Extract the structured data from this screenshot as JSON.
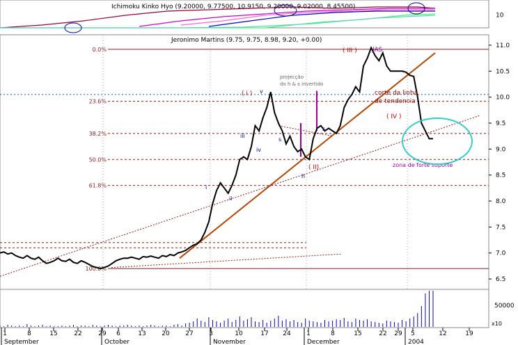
{
  "chart_data": {
    "type": "line",
    "top_panel": {
      "title": "Ichimoku Kinko Hyo (9.20000, 9.77500, 10.9150, 9.20000, 9.02000, 8.45500)",
      "y_ticks": [
        {
          "v": 10,
          "label": "10"
        }
      ],
      "ylim": [
        9.0,
        10.6
      ]
    },
    "main_panel": {
      "title": "Jeronimo Martins (9.75, 9.75, 8.98, 9.20, +0.00)",
      "ylim": [
        6.3,
        11.2
      ],
      "y_ticks": [
        {
          "v": 11.0,
          "label": "11.0"
        },
        {
          "v": 10.5,
          "label": "10.5"
        },
        {
          "v": 10.0,
          "label": "10.0"
        },
        {
          "v": 9.5,
          "label": "9.5"
        },
        {
          "v": 9.0,
          "label": "9.0"
        },
        {
          "v": 8.5,
          "label": "8.5"
        },
        {
          "v": 8.0,
          "label": "8.0"
        },
        {
          "v": 7.5,
          "label": "7.5"
        },
        {
          "v": 7.0,
          "label": "7.0"
        },
        {
          "v": 6.5,
          "label": "6.5"
        }
      ],
      "price_series": {
        "name": "Jeronimo Martins",
        "color": "#000000",
        "values": [
          7.0,
          7.02,
          6.98,
          7.0,
          6.95,
          6.92,
          6.9,
          6.95,
          6.9,
          6.88,
          6.92,
          6.85,
          6.8,
          6.82,
          6.85,
          6.9,
          6.85,
          6.84,
          6.88,
          6.82,
          6.8,
          6.85,
          6.82,
          6.78,
          6.74,
          6.72,
          6.7,
          6.72,
          6.75,
          6.8,
          6.85,
          6.88,
          6.9,
          6.9,
          6.92,
          6.9,
          6.88,
          6.93,
          6.92,
          6.94,
          6.92,
          6.9,
          6.95,
          6.93,
          6.97,
          6.95,
          7.0,
          7.02,
          7.05,
          7.1,
          7.15,
          7.18,
          7.25,
          7.4,
          7.6,
          7.95,
          8.2,
          8.35,
          8.25,
          8.15,
          8.3,
          8.5,
          8.8,
          8.85,
          8.8,
          9.05,
          9.45,
          9.35,
          9.6,
          9.8,
          10.1,
          9.7,
          9.5,
          9.35,
          9.1,
          9.25,
          9.05,
          8.95,
          9.0,
          8.85,
          8.8,
          9.2,
          9.4,
          9.45,
          9.35,
          9.4,
          9.35,
          9.3,
          9.45,
          9.8,
          9.95,
          10.05,
          10.2,
          10.1,
          10.6,
          10.75,
          10.95,
          10.8,
          10.7,
          10.85,
          10.6,
          10.5,
          10.5,
          10.5,
          10.5,
          10.48,
          10.42,
          10.4,
          10.0,
          9.5,
          9.35,
          9.2,
          9.2
        ]
      },
      "fibonacci_levels": [
        {
          "label": "0.0%",
          "v": 10.92
        },
        {
          "label": "23.6%",
          "v": 9.92
        },
        {
          "label": "38.2%",
          "v": 9.3
        },
        {
          "label": "50.0%",
          "v": 8.8
        },
        {
          "label": "61.8%",
          "v": 8.3
        },
        {
          "label": "100.0%",
          "v": 6.7
        }
      ],
      "other_levels": [
        10.05,
        7.2,
        7.1
      ],
      "annotations": [
        {
          "text": "( i )",
          "color": "#cc0000"
        },
        {
          "text": "v",
          "color": "#000099"
        },
        {
          "text": "iii",
          "color": "#000099"
        },
        {
          "text": "iv",
          "color": "#000099"
        },
        {
          "text": "i",
          "color": "#000099"
        },
        {
          "text": "ii",
          "color": "#000099"
        },
        {
          "text": "s",
          "color": "#000099"
        },
        {
          "text": "h",
          "color": "#000099"
        },
        {
          "text": "s",
          "color": "#000099"
        },
        {
          "text": "( II)",
          "color": "#cc0000"
        },
        {
          "text": "( III )",
          "color": "#cc0000"
        },
        {
          "text": "JAS",
          "color": "#990099"
        },
        {
          "text": "( IV )",
          "color": "#cc0000"
        },
        {
          "text": "projecção",
          "color": "#666666"
        },
        {
          "text": "do h & s invertido",
          "color": "#666666"
        },
        {
          "text": "corte da linha",
          "color": "#990000"
        },
        {
          "text": "de tendencia",
          "color": "#990000"
        },
        {
          "text": "zona de forte suporte",
          "color": "#990099"
        }
      ]
    },
    "volume_panel": {
      "y_ticks": [
        {
          "v": 50000,
          "label": "50000"
        }
      ],
      "multiplier_label": "x10",
      "color": "#0000cc",
      "values": [
        0,
        0,
        0,
        0,
        0,
        0,
        0,
        0,
        0,
        0,
        0,
        0,
        0,
        0,
        0,
        0,
        0,
        0,
        0,
        0,
        0,
        0,
        0,
        0,
        0,
        0,
        0,
        0,
        0,
        0,
        0,
        0,
        0,
        0,
        0,
        0,
        0,
        0,
        0,
        0,
        0,
        0,
        0,
        0,
        0,
        0,
        0,
        0,
        0,
        0,
        0,
        0,
        0,
        0,
        0,
        0,
        0,
        0,
        0,
        0,
        0,
        0,
        0,
        0,
        0,
        0,
        0,
        0,
        0,
        0,
        0,
        0,
        0,
        0,
        0,
        0,
        0,
        0,
        0,
        0,
        0,
        0,
        0,
        0,
        0,
        0,
        0,
        0,
        0,
        0,
        0,
        0,
        0,
        0,
        0,
        0,
        0,
        0,
        0,
        0,
        0,
        0,
        0,
        0,
        0,
        0,
        0,
        0,
        0,
        0,
        0,
        0,
        0
      ]
    },
    "x_axis": {
      "day_ticks": [
        "1",
        "8",
        "15",
        "22",
        "29",
        "6",
        "13",
        "20",
        "27",
        "3",
        "10",
        "17",
        "24",
        "1",
        "8",
        "15",
        "22",
        "29",
        "5",
        "12",
        "19"
      ],
      "month_labels": [
        "September",
        "October",
        "November",
        "December",
        "2004"
      ]
    }
  }
}
